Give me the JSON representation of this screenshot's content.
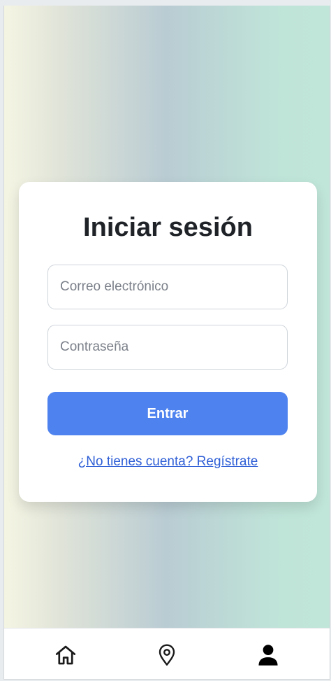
{
  "login": {
    "title": "Iniciar sesión",
    "email_placeholder": "Correo electrónico",
    "password_placeholder": "Contraseña",
    "submit_label": "Entrar",
    "register_link": "¿No tienes cuenta? Regístrate"
  },
  "nav": {
    "items": [
      {
        "icon": "home-icon"
      },
      {
        "icon": "location-pin-icon"
      },
      {
        "icon": "user-icon"
      }
    ]
  },
  "colors": {
    "accent": "#4e83ef",
    "link": "#2f5fd6",
    "title_text": "#1f2328",
    "card_bg": "#ffffff"
  }
}
